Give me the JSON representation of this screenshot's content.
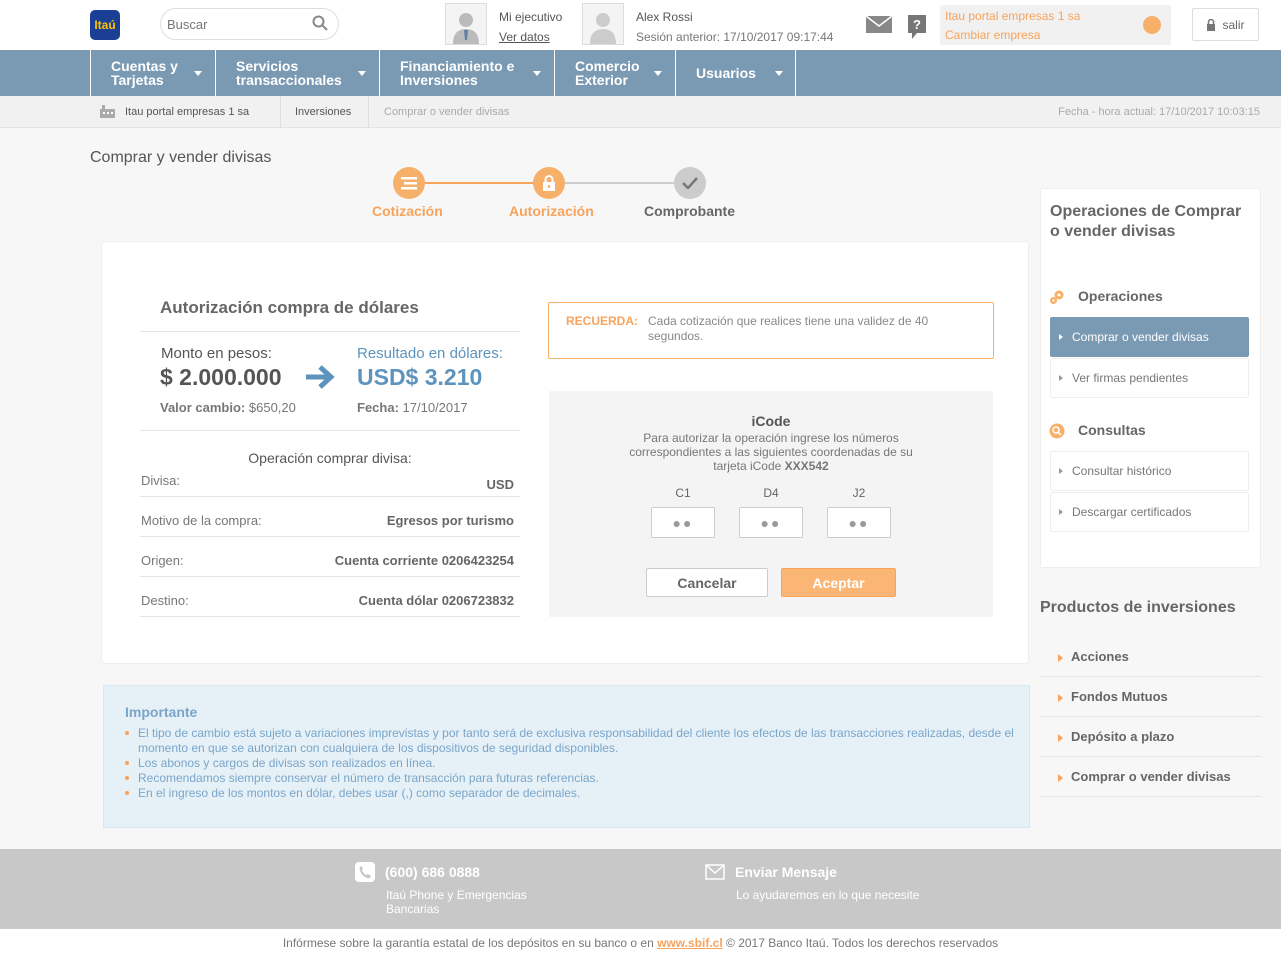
{
  "header": {
    "logo_text": "Itaú",
    "search_placeholder": "Buscar",
    "executive_label": "Mi ejecutivo",
    "executive_link": "Ver datos",
    "user_name": "Alex Rossi",
    "session_text": "Sesión anterior: 17/10/2017 09:17:44",
    "company_name": "Itau portal empresas 1 sa",
    "company_change": "Cambiar empresa",
    "logout_label": "salir"
  },
  "nav": {
    "items": [
      {
        "line1": "Cuentas y",
        "line2": "Tarjetas"
      },
      {
        "line1": "Servicios",
        "line2": "transaccionales"
      },
      {
        "line1": "Financiamiento e",
        "line2": "Inversiones"
      },
      {
        "line1": "Comercio",
        "line2": "Exterior"
      },
      {
        "line1": "Usuarios",
        "line2": ""
      }
    ]
  },
  "breadcrumb": {
    "items": [
      "Itau portal empresas 1 sa",
      "Inversiones",
      "Comprar o vender divisas"
    ],
    "datetime": "Fecha - hora actual: 17/10/2017 10:03:15"
  },
  "page": {
    "title": "Comprar y vender divisas"
  },
  "steps": [
    {
      "label": "Cotización",
      "state": "done"
    },
    {
      "label": "Autorización",
      "state": "current"
    },
    {
      "label": "Comprobante",
      "state": "pending"
    }
  ],
  "summary": {
    "title": "Autorización compra de dólares",
    "amount_label": "Monto en pesos:",
    "amount_value": "$ 2.000.000",
    "result_label": "Resultado en dólares:",
    "result_value": "USD$ 3.210",
    "rate_label": "Valor cambio:",
    "rate_value": "$650,20",
    "date_label": "Fecha:",
    "date_value": "17/10/2017",
    "operation_title": "Operación comprar divisa:",
    "rows": [
      {
        "label": "Divisa:",
        "value": "USD"
      },
      {
        "label": "Motivo de la compra:",
        "value": "Egresos por turismo"
      },
      {
        "label": "Origen:",
        "value": "Cuenta corriente 0206423254"
      },
      {
        "label": "Destino:",
        "value": "Cuenta dólar 0206723832"
      }
    ]
  },
  "reminder": {
    "title": "RECUERDA:",
    "text": "Cada cotización que realices tiene una validez de 40 segundos."
  },
  "icode": {
    "title": "iCode",
    "description": "Para autorizar la operación ingrese los números correspondientes a las siguientes coordenadas de su tarjeta iCode",
    "card_id": "XXX542",
    "coordinates": [
      {
        "label": "C1",
        "value": "●●"
      },
      {
        "label": "D4",
        "value": "●●"
      },
      {
        "label": "J2",
        "value": "●●"
      }
    ],
    "cancel_label": "Cancelar",
    "accept_label": "Aceptar"
  },
  "important": {
    "title": "Importante",
    "items": [
      "El tipo de cambio está sujeto a variaciones imprevistas y por tanto será de exclusiva responsabilidad del cliente los efectos de las transacciones realizadas, desde el momento en que se autorizan con cualquiera de los dispositivos de seguridad disponibles.",
      "Los abonos y cargos de divisas son realizados en línea.",
      "Recomendamos siempre conservar el número de transacción para futuras referencias.",
      "En el ingreso de los montos en dólar, debes usar (,) como separador de decimales."
    ]
  },
  "sidebar": {
    "title": "Operaciones de Comprar o vender divisas",
    "sections": [
      {
        "title": "Operaciones",
        "links": [
          "Comprar o vender divisas",
          "Ver firmas pendientes"
        ]
      },
      {
        "title": "Consultas",
        "links": [
          "Consultar histórico",
          "Descargar certificados"
        ]
      }
    ],
    "products_title": "Productos de inversiones",
    "products": [
      "Acciones",
      "Fondos Mutuos",
      "Depósito a plazo",
      "Comprar o vender divisas"
    ]
  },
  "footer": {
    "phone": "(600) 686 0888",
    "phone_sub": "Itaú Phone y Emergencias Bancarias",
    "message_title": "Enviar Mensaje",
    "message_sub": "Lo ayudaremos en lo que necesite",
    "legal_prefix": "Infórmese sobre la garantía estatal de los depósitos en su banco o en",
    "legal_link": "www.sbif.cl",
    "legal_suffix": "© 2017 Banco Itaú. Todos los derechos reservados"
  },
  "colors": {
    "accent": "#f7a35c",
    "nav": "#7a99b3",
    "result": "#5d94be"
  }
}
